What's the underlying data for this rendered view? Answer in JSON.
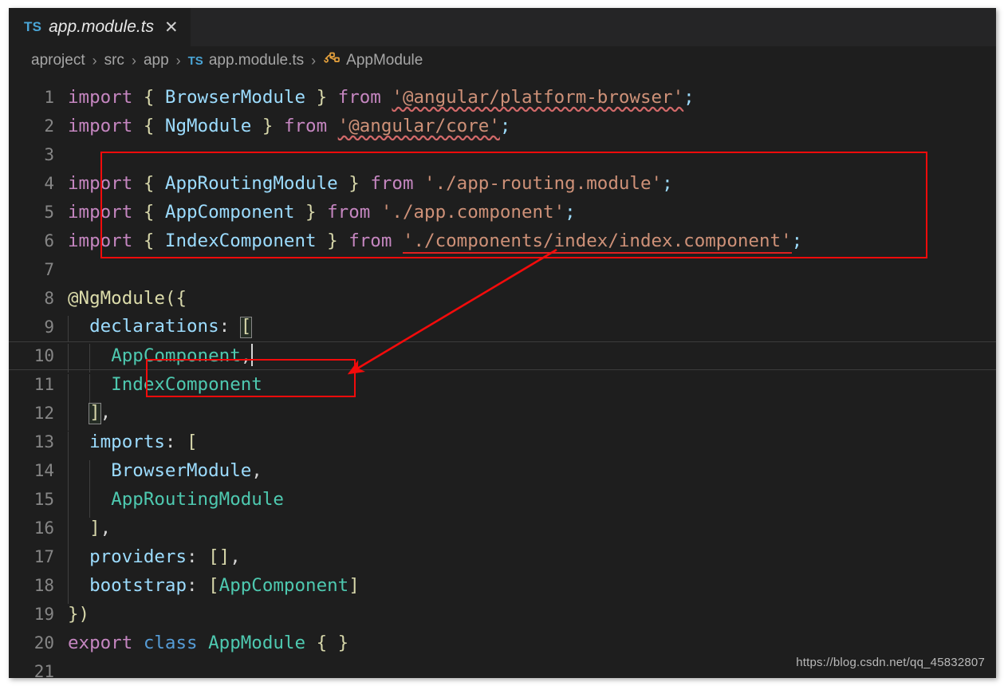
{
  "window": {
    "background": "#1e1e1e",
    "accent_red": "#f30b0b"
  },
  "tab": {
    "language_badge": "TS",
    "title": "app.module.ts",
    "close_glyph": "✕"
  },
  "breadcrumb": {
    "items": [
      {
        "label": "aproject",
        "icon": ""
      },
      {
        "label": "src",
        "icon": ""
      },
      {
        "label": "app",
        "icon": ""
      },
      {
        "label": "app.module.ts",
        "icon": "ts-badge"
      },
      {
        "label": "AppModule",
        "icon": "class-icon"
      }
    ],
    "separator": "›",
    "ts_badge": "TS"
  },
  "editor": {
    "language": "typescript",
    "current_line": 10,
    "lines": [
      {
        "n": "1",
        "segments": [
          {
            "t": "import ",
            "c": "t-kw"
          },
          {
            "t": "{ ",
            "c": "t-brace"
          },
          {
            "t": "BrowserModule",
            "c": "t-type"
          },
          {
            "t": " } ",
            "c": "t-brace"
          },
          {
            "t": "from ",
            "c": "t-kw"
          },
          {
            "t": "'@angular/platform-browser'",
            "c": "t-str squiggle"
          },
          {
            "t": ";",
            "c": "t-semi"
          }
        ]
      },
      {
        "n": "2",
        "segments": [
          {
            "t": "import ",
            "c": "t-kw"
          },
          {
            "t": "{ ",
            "c": "t-brace"
          },
          {
            "t": "NgModule",
            "c": "t-type"
          },
          {
            "t": " } ",
            "c": "t-brace"
          },
          {
            "t": "from ",
            "c": "t-kw"
          },
          {
            "t": "'@angular/core'",
            "c": "t-str squiggle"
          },
          {
            "t": ";",
            "c": "t-semi"
          }
        ]
      },
      {
        "n": "3",
        "segments": []
      },
      {
        "n": "4",
        "segments": [
          {
            "t": "import ",
            "c": "t-kw"
          },
          {
            "t": "{ ",
            "c": "t-brace"
          },
          {
            "t": "AppRoutingModule",
            "c": "t-type"
          },
          {
            "t": " } ",
            "c": "t-brace"
          },
          {
            "t": "from ",
            "c": "t-kw"
          },
          {
            "t": "'./app-routing.module'",
            "c": "t-str"
          },
          {
            "t": ";",
            "c": "t-semi"
          }
        ]
      },
      {
        "n": "5",
        "segments": [
          {
            "t": "import ",
            "c": "t-kw"
          },
          {
            "t": "{ ",
            "c": "t-brace"
          },
          {
            "t": "AppComponent",
            "c": "t-type"
          },
          {
            "t": " } ",
            "c": "t-brace"
          },
          {
            "t": "from ",
            "c": "t-kw"
          },
          {
            "t": "'./app.component'",
            "c": "t-str"
          },
          {
            "t": ";",
            "c": "t-semi"
          }
        ]
      },
      {
        "n": "6",
        "segments": [
          {
            "t": "import ",
            "c": "t-kw"
          },
          {
            "t": "{ ",
            "c": "t-brace"
          },
          {
            "t": "IndexComponent",
            "c": "t-type"
          },
          {
            "t": " } ",
            "c": "t-brace"
          },
          {
            "t": "from ",
            "c": "t-kw"
          },
          {
            "t": "'./components/index/index.component'",
            "c": "t-str err-underline"
          },
          {
            "t": ";",
            "c": "t-semi"
          }
        ]
      },
      {
        "n": "7",
        "segments": []
      },
      {
        "n": "8",
        "segments": [
          {
            "t": "@NgModule",
            "c": "t-deco"
          },
          {
            "t": "({",
            "c": "t-brace"
          }
        ]
      },
      {
        "n": "9",
        "segments": [
          {
            "t": "  ",
            "c": "t-punc"
          },
          {
            "t": "declarations",
            "c": "t-type"
          },
          {
            "t": ": ",
            "c": "t-punc"
          },
          {
            "t": "[",
            "c": "t-brace bracket-match"
          }
        ]
      },
      {
        "n": "10",
        "segments": [
          {
            "t": "    ",
            "c": "t-punc"
          },
          {
            "t": "AppComponent",
            "c": "t-type2"
          },
          {
            "t": ",",
            "c": "t-punc"
          }
        ],
        "caret_after": true
      },
      {
        "n": "11",
        "segments": [
          {
            "t": "    ",
            "c": "t-punc"
          },
          {
            "t": "IndexComponent",
            "c": "t-type2"
          }
        ]
      },
      {
        "n": "12",
        "segments": [
          {
            "t": "  ",
            "c": "t-punc"
          },
          {
            "t": "]",
            "c": "t-brace bracket-match"
          },
          {
            "t": ",",
            "c": "t-punc"
          }
        ]
      },
      {
        "n": "13",
        "segments": [
          {
            "t": "  ",
            "c": "t-punc"
          },
          {
            "t": "imports",
            "c": "t-type"
          },
          {
            "t": ": ",
            "c": "t-punc"
          },
          {
            "t": "[",
            "c": "t-brace"
          }
        ]
      },
      {
        "n": "14",
        "segments": [
          {
            "t": "    ",
            "c": "t-punc"
          },
          {
            "t": "BrowserModule",
            "c": "t-type"
          },
          {
            "t": ",",
            "c": "t-punc"
          }
        ]
      },
      {
        "n": "15",
        "segments": [
          {
            "t": "    ",
            "c": "t-punc"
          },
          {
            "t": "AppRoutingModule",
            "c": "t-type2"
          }
        ]
      },
      {
        "n": "16",
        "segments": [
          {
            "t": "  ",
            "c": "t-punc"
          },
          {
            "t": "]",
            "c": "t-brace"
          },
          {
            "t": ",",
            "c": "t-punc"
          }
        ]
      },
      {
        "n": "17",
        "segments": [
          {
            "t": "  ",
            "c": "t-punc"
          },
          {
            "t": "providers",
            "c": "t-type"
          },
          {
            "t": ": ",
            "c": "t-punc"
          },
          {
            "t": "[]",
            "c": "t-brace"
          },
          {
            "t": ",",
            "c": "t-punc"
          }
        ]
      },
      {
        "n": "18",
        "segments": [
          {
            "t": "  ",
            "c": "t-punc"
          },
          {
            "t": "bootstrap",
            "c": "t-type"
          },
          {
            "t": ": ",
            "c": "t-punc"
          },
          {
            "t": "[",
            "c": "t-brace"
          },
          {
            "t": "AppComponent",
            "c": "t-type2"
          },
          {
            "t": "]",
            "c": "t-brace"
          }
        ]
      },
      {
        "n": "19",
        "segments": [
          {
            "t": "})",
            "c": "t-brace"
          }
        ]
      },
      {
        "n": "20",
        "segments": [
          {
            "t": "export ",
            "c": "t-kw"
          },
          {
            "t": "class ",
            "c": "t-kw2"
          },
          {
            "t": "AppModule",
            "c": "t-type2"
          },
          {
            "t": " { }",
            "c": "t-brace"
          }
        ]
      },
      {
        "n": "21",
        "segments": []
      }
    ]
  },
  "annotations": {
    "color": "#f30b0b",
    "box_imports_label": "imports-highlight-box",
    "box_index_label": "index-component-highlight-box",
    "arrow_label": "index-component-arrow"
  },
  "watermark": {
    "text": "https://blog.csdn.net/qq_45832807"
  }
}
